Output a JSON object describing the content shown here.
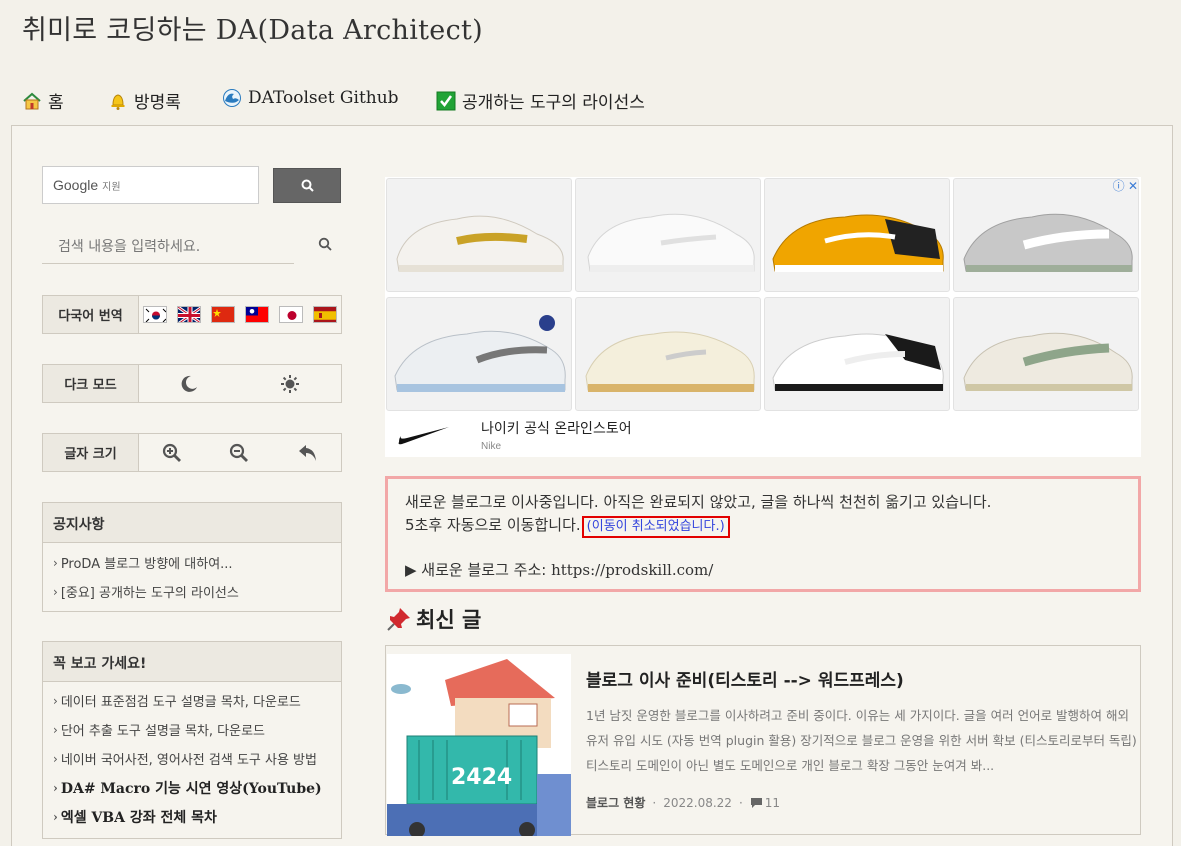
{
  "site": {
    "title": "취미로 코딩하는 DA(Data Architect)"
  },
  "nav": {
    "items": [
      {
        "label": "홈",
        "icon": "home-icon"
      },
      {
        "label": "방명록",
        "icon": "bell-icon"
      },
      {
        "label": "DAToolset Github",
        "icon": "wave-icon"
      },
      {
        "label": "공개하는 도구의 라이선스",
        "icon": "checkbox-icon"
      }
    ]
  },
  "sidebar": {
    "google_search": {
      "brand": "Google",
      "sub": "지원",
      "button_icon": "search-icon"
    },
    "blog_search": {
      "placeholder": "검색 내용을 입력하세요."
    },
    "translate": {
      "label": "다국어 번역",
      "flags": [
        "Korea",
        "UK",
        "China",
        "Taiwan",
        "Japan",
        "Spain"
      ]
    },
    "dark_mode": {
      "label": "다크 모드"
    },
    "font_size": {
      "label": "글자 크기"
    },
    "notices": {
      "title": "공지사항",
      "items": [
        "ProDA 블로그 방향에 대하여...",
        "[중요] 공개하는 도구의 라이선스"
      ]
    },
    "must_read": {
      "title": "꼭 보고 가세요!",
      "items": [
        "데이터 표준점검 도구 설명글 목차, 다운로드",
        "단어 추출 도구 설명글 목차, 다운로드",
        "네이버 국어사전, 영어사전 검색 도구 사용 방법",
        "DA# Macro 기능 시연 영상(YouTube)",
        "엑셀 VBA 강좌 전체 목차"
      ]
    }
  },
  "ad": {
    "brand_name": "나이키 공식 온라인스토어",
    "brand_sub": "Nike",
    "close_glyph": "ⓘ ✕"
  },
  "notice": {
    "line1": "새로운 블로그로 이사중입니다. 아직은 완료되지 않았고, 글을 하나씩 천천히 옮기고 있습니다.",
    "line2": "5초후 자동으로 이동합니다.",
    "cancel": "(이동이 취소되었습니다.)",
    "address_prefix": "▶ 새로운 블로그 주소: ",
    "address_url": "https://prodskill.com/"
  },
  "recent": {
    "title": "최신 글",
    "post": {
      "title": "블로그 이사 준비(티스토리 --> 워드프레스)",
      "excerpt": "1년 남짓 운영한 블로그를 이사하려고 준비 중이다. 이유는 세 가지이다. 글을 여러 언어로 발행하여 해외 유저 유입 시도 (자동 번역 plugin 활용) 장기적으로 블로그 운영을 위한 서버 확보 (티스토리로부터 독립) 티스토리 도메인이 아닌 별도 도메인으로 개인 블로그 확장 그동안 눈여겨 봐...",
      "category": "블로그 현황",
      "date": "2022.08.22",
      "comments": "11",
      "thumb_text": "2424"
    }
  }
}
